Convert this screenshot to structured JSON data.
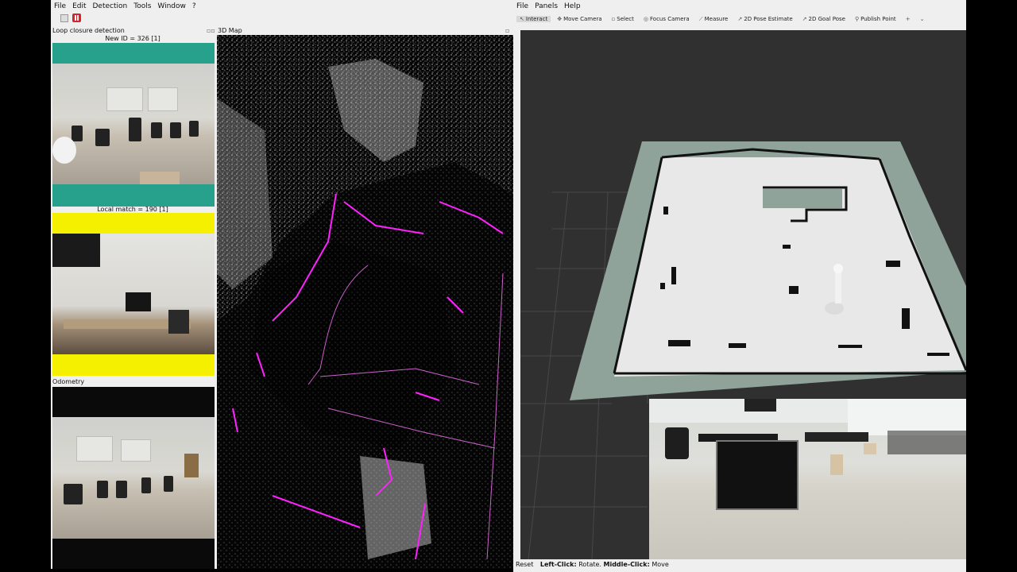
{
  "left_app": {
    "menu": [
      "File",
      "Edit",
      "Detection",
      "Tools",
      "Window",
      "?"
    ],
    "loop_closure": {
      "title": "Loop closure detection",
      "new_id": "New ID = 326 [1]",
      "local_match": "Local match = 190 [1]"
    },
    "odometry": {
      "title": "Odometry"
    },
    "map3d": {
      "title": "3D Map"
    }
  },
  "right_app": {
    "menu": [
      "File",
      "Panels",
      "Help"
    ],
    "tools": [
      {
        "label": "Interact",
        "icon": "cursor-icon"
      },
      {
        "label": "Move Camera",
        "icon": "move-camera-icon"
      },
      {
        "label": "Select",
        "icon": "select-icon"
      },
      {
        "label": "Focus Camera",
        "icon": "focus-camera-icon"
      },
      {
        "label": "Measure",
        "icon": "measure-icon"
      },
      {
        "label": "2D Pose Estimate",
        "icon": "pose-estimate-icon"
      },
      {
        "label": "2D Goal Pose",
        "icon": "goal-pose-icon"
      },
      {
        "label": "Publish Point",
        "icon": "publish-point-icon"
      }
    ],
    "status": {
      "reset": "Reset",
      "left_click": "Left-Click:",
      "rotate": "Rotate.",
      "middle_click": "Middle-Click:",
      "move": "Move"
    }
  },
  "colors": {
    "teal": "#27a08c",
    "yellow": "#f5ef00",
    "trajectory": "#ff22ff"
  }
}
